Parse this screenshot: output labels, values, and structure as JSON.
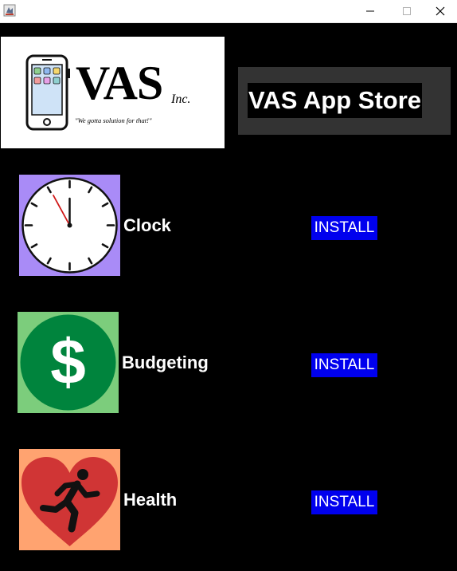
{
  "window": {
    "min_icon": "minimize-icon",
    "max_icon": "maximize-icon",
    "close_icon": "close-icon"
  },
  "logo": {
    "brand": "VAS",
    "suffix": "Inc.",
    "tagline": "\"We gotta solution for that!\""
  },
  "store": {
    "title": "VAS App Store"
  },
  "apps": [
    {
      "name": "Clock",
      "install_label": "INSTALL",
      "icon": "clock-icon",
      "tile_color": "#a98bf7"
    },
    {
      "name": "Budgeting",
      "install_label": "INSTALL",
      "icon": "dollar-icon",
      "tile_color": "#7ccd7c"
    },
    {
      "name": "Health",
      "install_label": "INSTALL",
      "icon": "heart-runner-icon",
      "tile_color": "#ffa370"
    }
  ],
  "colors": {
    "background": "#000000",
    "install_button": "#0000ee",
    "store_panel": "#333333"
  }
}
